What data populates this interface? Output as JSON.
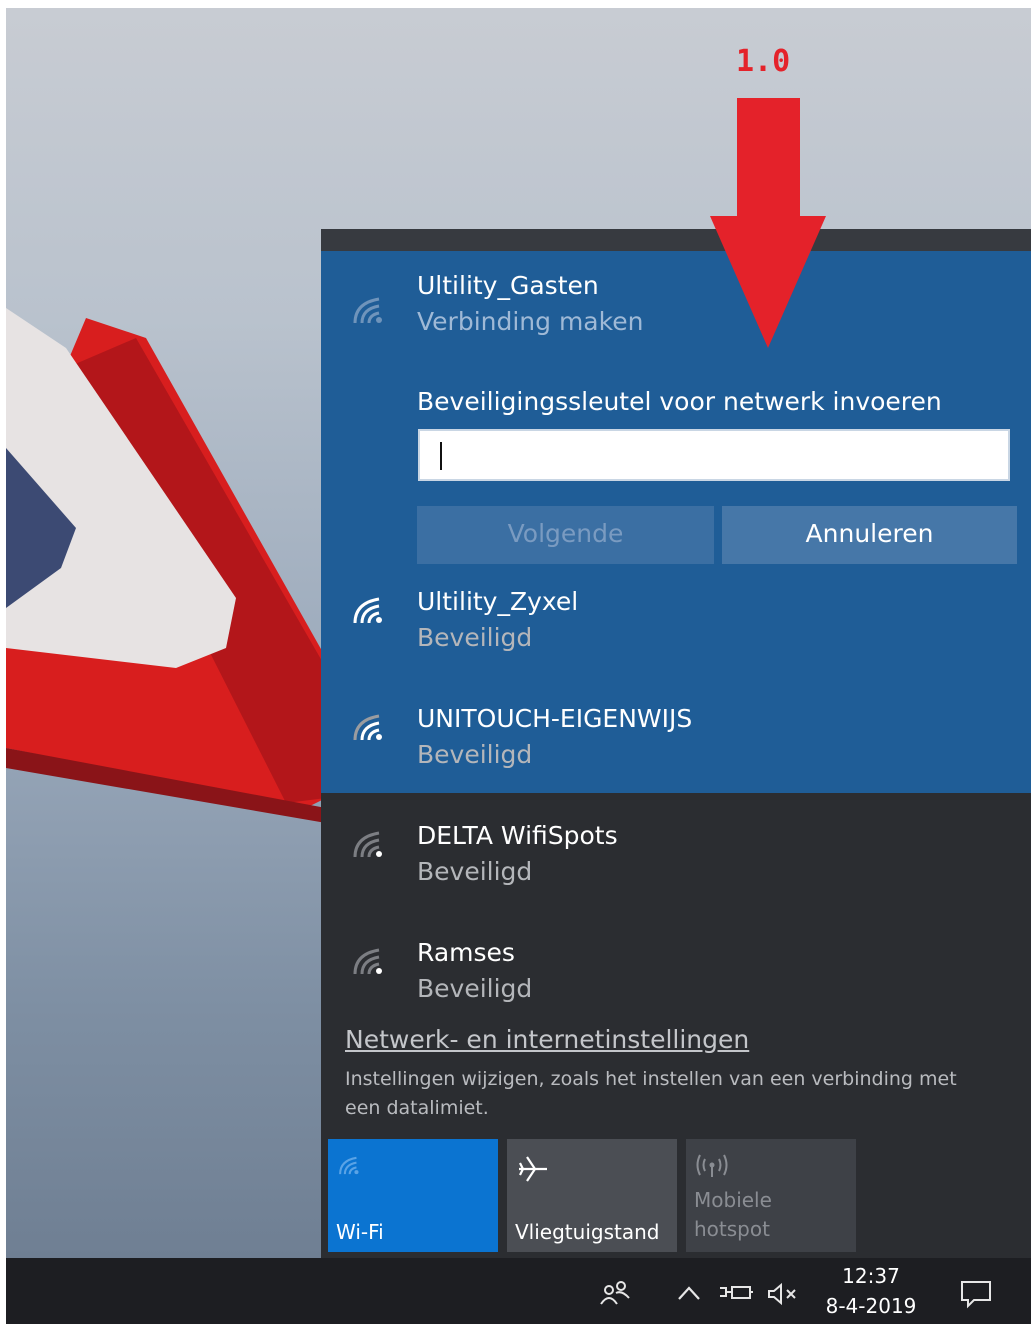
{
  "annotation": {
    "label": "1.0"
  },
  "selected_network": {
    "name": "Ultility_Gasten",
    "status": "Verbinding maken",
    "key_prompt": "Beveiligingssleutel voor netwerk invoeren",
    "key_value": "",
    "next_button": "Volgende",
    "cancel_button": "Annuleren"
  },
  "networks": [
    {
      "name": "Ultility_Zyxel",
      "status": "Beveiligd",
      "icon": "wifi-signal-icon"
    },
    {
      "name": "UNITOUCH-EIGENWIJS",
      "status": "Beveiligd",
      "icon": "wifi-signal-icon"
    },
    {
      "name": "DELTA WifiSpots",
      "status": "Beveiligd",
      "icon": "wifi-signal-icon"
    },
    {
      "name": "Ramses",
      "status": "Beveiligd",
      "icon": "wifi-signal-icon"
    }
  ],
  "settings": {
    "link": "Netwerk- en internetinstellingen",
    "description": "Instellingen wijzigen, zoals het instellen van een verbinding met een datalimiet."
  },
  "quick_actions": {
    "wifi": "Wi-Fi",
    "airplane": "Vliegtuigstand",
    "hotspot_line1": "Mobiele",
    "hotspot_line2": "hotspot"
  },
  "taskbar": {
    "time": "12:37",
    "date": "8-4-2019"
  },
  "colors": {
    "selected_bg": "#1f5d97",
    "flyout_bg": "#2b2d31",
    "wifi_tile": "#0b74d1",
    "annotation": "#e4222a"
  }
}
